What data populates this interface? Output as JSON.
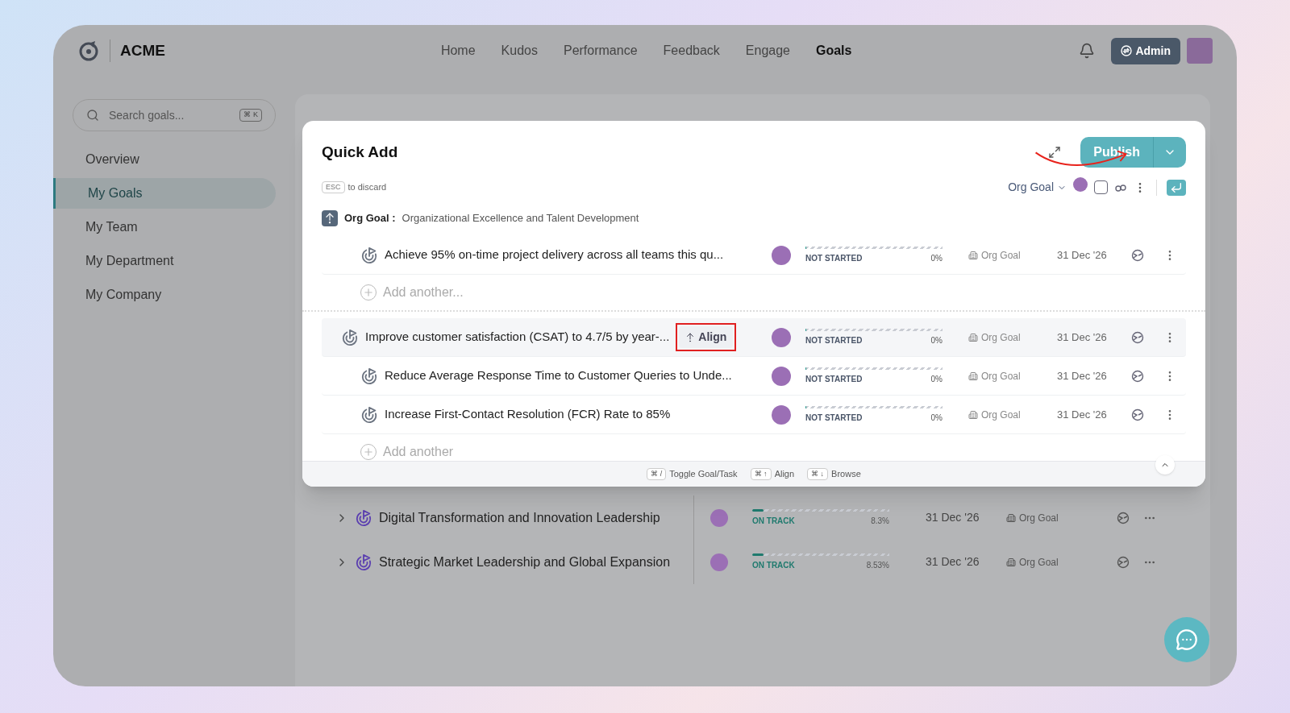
{
  "brand": {
    "name": "ACME"
  },
  "nav": [
    {
      "label": "Home",
      "selected": false
    },
    {
      "label": "Kudos",
      "selected": false
    },
    {
      "label": "Performance",
      "selected": false
    },
    {
      "label": "Feedback",
      "selected": false
    },
    {
      "label": "Engage",
      "selected": false
    },
    {
      "label": "Goals",
      "selected": true
    }
  ],
  "user": {
    "role": "Admin"
  },
  "sidebar": {
    "search": {
      "placeholder": "Search goals...",
      "shortcut": "⌘ K"
    },
    "items": [
      {
        "label": "Overview",
        "selected": false
      },
      {
        "label": "My Goals",
        "selected": true
      },
      {
        "label": "My Team",
        "selected": false
      },
      {
        "label": "My Department",
        "selected": false
      },
      {
        "label": "My Company",
        "selected": false
      }
    ]
  },
  "background_rows": [
    {
      "title": "Digital Transformation and Innovation Leadership",
      "status": "ON TRACK",
      "level": 0.083,
      "percent": "8.3%",
      "date": "31 Dec '26",
      "type": "Org Goal"
    },
    {
      "title": "Strategic Market Leadership and Global Expansion",
      "status": "ON TRACK",
      "level": 0.085,
      "percent": "8.53%",
      "date": "31 Dec '26",
      "type": "Org Goal"
    }
  ],
  "modal": {
    "title": "Quick Add",
    "publish": "Publish",
    "esc_key": "ESC",
    "esc_hint": "to discard",
    "goal_type": "Org Goal",
    "parent": {
      "label": "Org Goal :",
      "text": "Organizational Excellence and Talent Development"
    },
    "items": [
      {
        "kind": "child",
        "title": "Achieve 95% on-time project delivery across all teams this qu...",
        "status": "NOT STARTED",
        "level": 0,
        "percent": "0%",
        "type": "Org Goal",
        "date": "31 Dec '26"
      },
      {
        "kind": "add",
        "label": "Add another..."
      },
      {
        "kind": "parent",
        "title": "Improve customer satisfaction (CSAT) to 4.7/5 by year-...",
        "align": "Align",
        "status": "NOT STARTED",
        "level": 0,
        "percent": "0%",
        "type": "Org Goal",
        "date": "31 Dec '26"
      },
      {
        "kind": "child",
        "title": "Reduce Average Response Time to Customer Queries to Unde...",
        "status": "NOT STARTED",
        "level": 0,
        "percent": "0%",
        "type": "Org Goal",
        "date": "31 Dec '26"
      },
      {
        "kind": "child",
        "title": "Increase First-Contact Resolution (FCR) Rate to 85%",
        "status": "NOT STARTED",
        "level": 0,
        "percent": "0%",
        "type": "Org Goal",
        "date": "31 Dec '26"
      },
      {
        "kind": "add",
        "label": "Add another"
      }
    ],
    "shortcuts": [
      {
        "keys": "⌘ /",
        "label": "Toggle Goal/Task"
      },
      {
        "keys": "⌘ ↑",
        "label": "Align"
      },
      {
        "keys": "⌘ ↓",
        "label": "Browse"
      }
    ]
  }
}
